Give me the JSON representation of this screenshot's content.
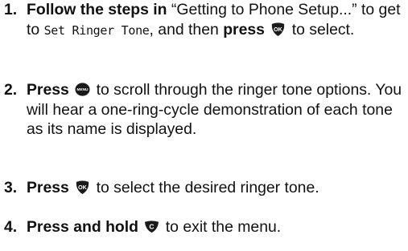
{
  "steps": [
    {
      "number": "1.",
      "lead": "Follow the steps in",
      "quote": "“Getting to Phone Setup...”",
      "to_get_to": "to get to",
      "screen_text": "Set Ringer Tone",
      "then": ", and then",
      "action": "press",
      "key_icon": "ok-key-icon",
      "tail": "to select."
    },
    {
      "number": "2.",
      "action": "Press",
      "key_icon": "menu-key-icon",
      "tail": "to scroll through the ringer tone options. You will hear a one-ring-cycle demonstration of each tone as its name is displayed."
    },
    {
      "number": "3.",
      "action": "Press",
      "key_icon": "ok-key-icon",
      "tail": "to select the desired ringer tone."
    },
    {
      "number": "4.",
      "action": "Press and hold",
      "key_icon": "c-key-icon",
      "tail": "to exit the menu."
    }
  ],
  "icon_labels": {
    "ok": "OK",
    "menu": "MENU",
    "c": "C"
  },
  "colors": {
    "text": "#111111",
    "key_fill": "#1a1a1a",
    "key_label": "#ffffff"
  }
}
